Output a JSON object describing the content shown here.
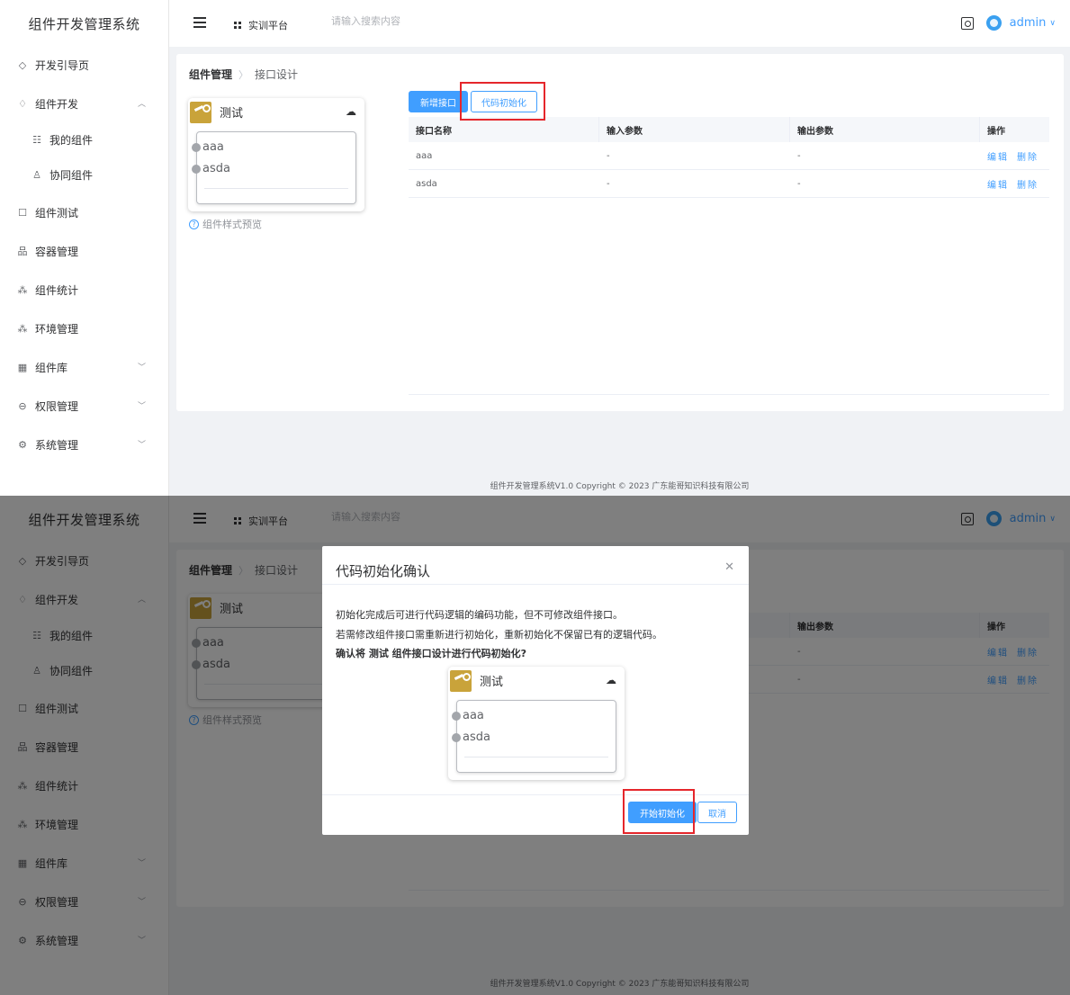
{
  "app": {
    "title": "组件开发管理系统",
    "platform": "实训平台",
    "search_placeholder": "请输入搜索内容",
    "username": "admin",
    "footer": "组件开发管理系统V1.0 Copyright © 2023 广东能哥知识科技有限公司"
  },
  "sidebar": {
    "items": [
      {
        "label": "开发引导页",
        "icon": "diamond-icon"
      },
      {
        "label": "组件开发",
        "icon": "bulb-icon",
        "expanded": true
      },
      {
        "label": "我的组件",
        "icon": "list-icon"
      },
      {
        "label": "协同组件",
        "icon": "users-icon"
      },
      {
        "label": "组件测试",
        "icon": "test-icon"
      },
      {
        "label": "容器管理",
        "icon": "tree-icon"
      },
      {
        "label": "组件统计",
        "icon": "stats-icon"
      },
      {
        "label": "环境管理",
        "icon": "env-icon"
      },
      {
        "label": "组件库",
        "icon": "grid-icon"
      },
      {
        "label": "权限管理",
        "icon": "lock-icon"
      },
      {
        "label": "系统管理",
        "icon": "gear-icon"
      }
    ]
  },
  "breadcrumb": {
    "parent": "组件管理",
    "current": "接口设计"
  },
  "component": {
    "name": "测试",
    "ports": [
      "aaa",
      "asda"
    ],
    "preview_label": "组件样式预览"
  },
  "toolbar": {
    "add_label": "新增接口",
    "init_label": "代码初始化"
  },
  "table": {
    "headers": [
      "接口名称",
      "输入参数",
      "输出参数",
      "操作"
    ],
    "rows": [
      {
        "name": "aaa",
        "input": "-",
        "output": "-",
        "edit": "编辑",
        "delete": "删除"
      },
      {
        "name": "asda",
        "input": "-",
        "output": "-",
        "edit": "编辑",
        "delete": "删除"
      }
    ]
  },
  "dialog": {
    "title": "代码初始化确认",
    "line1": "初始化完成后可进行代码逻辑的编码功能，但不可修改组件接口。",
    "line2": "若需修改组件接口需重新进行初始化，重新初始化不保留已有的逻辑代码。",
    "line3": "确认将 测试 组件接口设计进行代码初始化?",
    "confirm_label": "开始初始化",
    "cancel_label": "取消"
  },
  "colors": {
    "accent": "#409eff",
    "highlight": "#e5262b",
    "logo": "#c9a33a"
  }
}
